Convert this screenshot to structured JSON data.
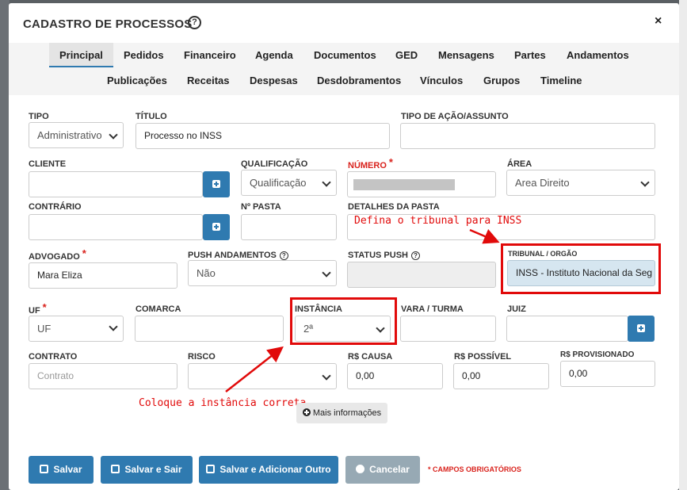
{
  "modal": {
    "title": "CADASTRO DE PROCESSOS",
    "close": "×"
  },
  "tabs": {
    "row1": [
      "Principal",
      "Pedidos",
      "Financeiro",
      "Agenda",
      "Documentos",
      "GED",
      "Mensagens",
      "Partes",
      "Andamentos"
    ],
    "row2": [
      "Publicações",
      "Receitas",
      "Despesas",
      "Desdobramentos",
      "Vínculos",
      "Grupos",
      "Timeline"
    ],
    "active": "Principal"
  },
  "form": {
    "tipo": {
      "label": "TIPO",
      "value": "Administrativo"
    },
    "titulo": {
      "label": "TÍTULO",
      "value": "Processo no INSS"
    },
    "tipo_acao": {
      "label": "TIPO DE AÇÃO/ASSUNTO",
      "value": ""
    },
    "cliente": {
      "label": "CLIENTE",
      "value": ""
    },
    "qualificacao": {
      "label": "QUALIFICAÇÃO",
      "value": "Qualificação"
    },
    "numero": {
      "label": "NÚMERO",
      "value": ""
    },
    "area": {
      "label": "ÁREA",
      "value": "Area Direito"
    },
    "contrario": {
      "label": "CONTRÁRIO",
      "value": ""
    },
    "n_pasta": {
      "label": "Nº PASTA",
      "value": ""
    },
    "detalhes_pasta": {
      "label": "DETALHES DA PASTA",
      "value": ""
    },
    "advogado": {
      "label": "ADVOGADO",
      "value": "Mara Eliza"
    },
    "push_andamentos": {
      "label": "PUSH ANDAMENTOS",
      "value": "Não"
    },
    "status_push": {
      "label": "STATUS PUSH",
      "value": ""
    },
    "tribunal": {
      "label": "TRIBUNAL / ORGÃO",
      "value": "INSS - Instituto Nacional da Seg"
    },
    "uf": {
      "label": "UF",
      "value": "UF"
    },
    "comarca": {
      "label": "COMARCA",
      "value": ""
    },
    "instancia": {
      "label": "INSTÂNCIA",
      "value": "2ª"
    },
    "vara_turma": {
      "label": "VARA / TURMA",
      "value": ""
    },
    "juiz": {
      "label": "JUIZ",
      "value": ""
    },
    "contrato": {
      "label": "CONTRATO",
      "placeholder": "Contrato"
    },
    "risco": {
      "label": "RISCO",
      "value": ""
    },
    "rs_causa": {
      "label": "R$ CAUSA",
      "value": "0,00"
    },
    "rs_possivel": {
      "label": "R$ POSSÍVEL",
      "value": "0,00"
    },
    "rs_provisionado": {
      "label": "R$ PROVISIONADO",
      "value": "0,00"
    }
  },
  "annotations": {
    "tribunal_note": "Defina o tribunal para INSS",
    "instancia_note": "Coloque a instância correta"
  },
  "more_info": "Mais informações",
  "buttons": {
    "salvar": "Salvar",
    "salvar_sair": "Salvar e Sair",
    "salvar_adicionar": "Salvar e Adicionar Outro",
    "cancelar": "Cancelar"
  },
  "required_note": "* CAMPOS OBRIGATÓRIOS",
  "colors": {
    "primary": "#2f7ab0",
    "annotation": "#e10a0a",
    "required": "#d9221c"
  }
}
